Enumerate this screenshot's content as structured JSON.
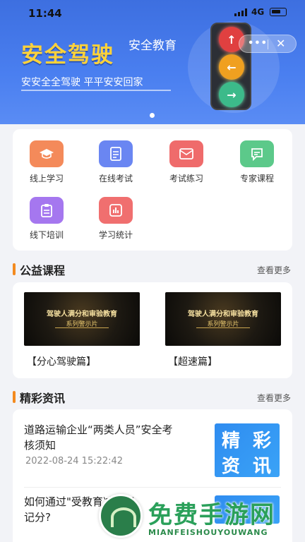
{
  "status_bar": {
    "time": "11:44",
    "network": "4G"
  },
  "banner": {
    "title": "安全驾驶",
    "subtitle": "安全教育",
    "slogan": "安安全全驾驶  平平安安回家",
    "capsule": {
      "more": "•••",
      "close": "✕"
    }
  },
  "menu": {
    "items": [
      {
        "label": "线上学习",
        "icon": "graduation-cap-icon",
        "color": "#f48a5a"
      },
      {
        "label": "在线考试",
        "icon": "document-icon",
        "color": "#6a86f2"
      },
      {
        "label": "考试练习",
        "icon": "envelope-icon",
        "color": "#ef6b6b"
      },
      {
        "label": "专家课程",
        "icon": "chat-icon",
        "color": "#5cc98a"
      },
      {
        "label": "线下培训",
        "icon": "clipboard-icon",
        "color": "#a577ef"
      },
      {
        "label": "学习统计",
        "icon": "stats-icon",
        "color": "#f06f6f"
      }
    ]
  },
  "courses": {
    "title": "公益课程",
    "more": "查看更多",
    "items": [
      {
        "label": "【分心驾驶篇】",
        "video_title": "驾驶人满分和审验教育",
        "video_sub": "系列警示片"
      },
      {
        "label": "【超速篇】",
        "video_title": "驾驶人满分和审验教育",
        "video_sub": "系列警示片"
      }
    ]
  },
  "news": {
    "title": "精彩资讯",
    "more": "查看更多",
    "thumb_text": [
      "精",
      "彩",
      "资",
      "讯"
    ],
    "items": [
      {
        "title_line1": "道路运输企业“两类人员”安全考",
        "title_line2": "核须知",
        "date": "2022-08-24 15:22:42"
      },
      {
        "title_line1": "如何通过\"受教育减免记",
        "title_line2": "记分?"
      }
    ]
  },
  "watermark": {
    "text": "免费手游网",
    "sub": "MIANFEISHOUYOUWANG"
  }
}
